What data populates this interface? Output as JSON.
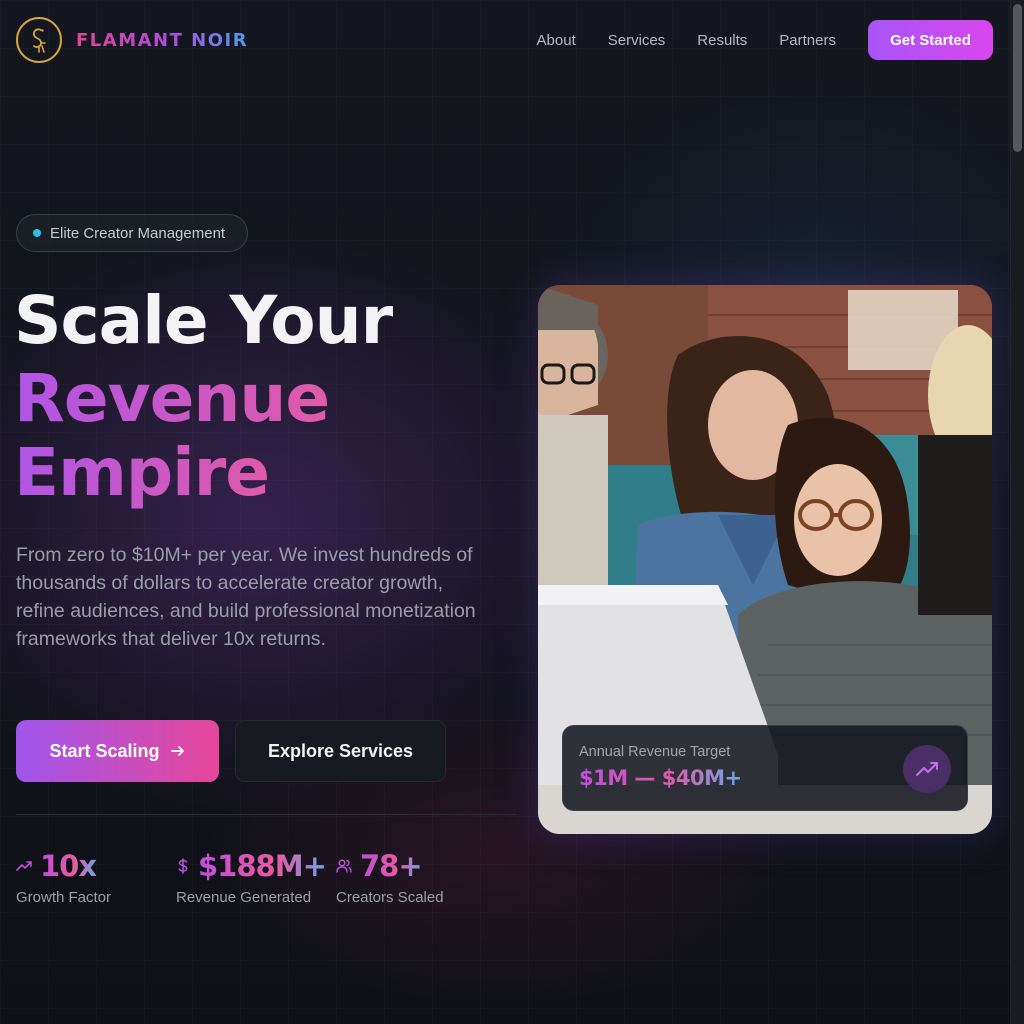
{
  "brand": {
    "name": "FLAMANT NOIR",
    "logo_icon": "flamingo-logo-icon",
    "logo_color": "#d4a53a"
  },
  "nav": {
    "links": [
      "About",
      "Services",
      "Results",
      "Partners"
    ],
    "cta_label": "Get Started"
  },
  "hero": {
    "badge": "Elite Creator Management",
    "title_line1": "Scale Your",
    "title_line2": "Revenue",
    "title_line3": "Empire",
    "subtitle": "From zero to $10M+ per year. We invest hundreds of thousands of dollars to accelerate creator growth, refine audiences, and build professional monetization frameworks that deliver 10x returns.",
    "primary_button": "Start Scaling",
    "secondary_button": "Explore Services"
  },
  "stats": [
    {
      "icon": "trending-up-icon",
      "value": "10x",
      "label": "Growth Factor"
    },
    {
      "icon": "dollar-icon",
      "value": "$188M+",
      "label": "Revenue Generated"
    },
    {
      "icon": "users-icon",
      "value": "78+",
      "label": "Creators Scaled"
    }
  ],
  "image_card": {
    "overlay_label": "Annual Revenue Target",
    "overlay_value": "$1M — $40M+",
    "overlay_icon": "trending-up-icon"
  },
  "colors": {
    "accent_purple": "#a855f7",
    "accent_pink": "#e7479a",
    "accent_blue": "#4aa0e8",
    "badge_dot": "#22c4e0",
    "background": "#0d0f17"
  }
}
